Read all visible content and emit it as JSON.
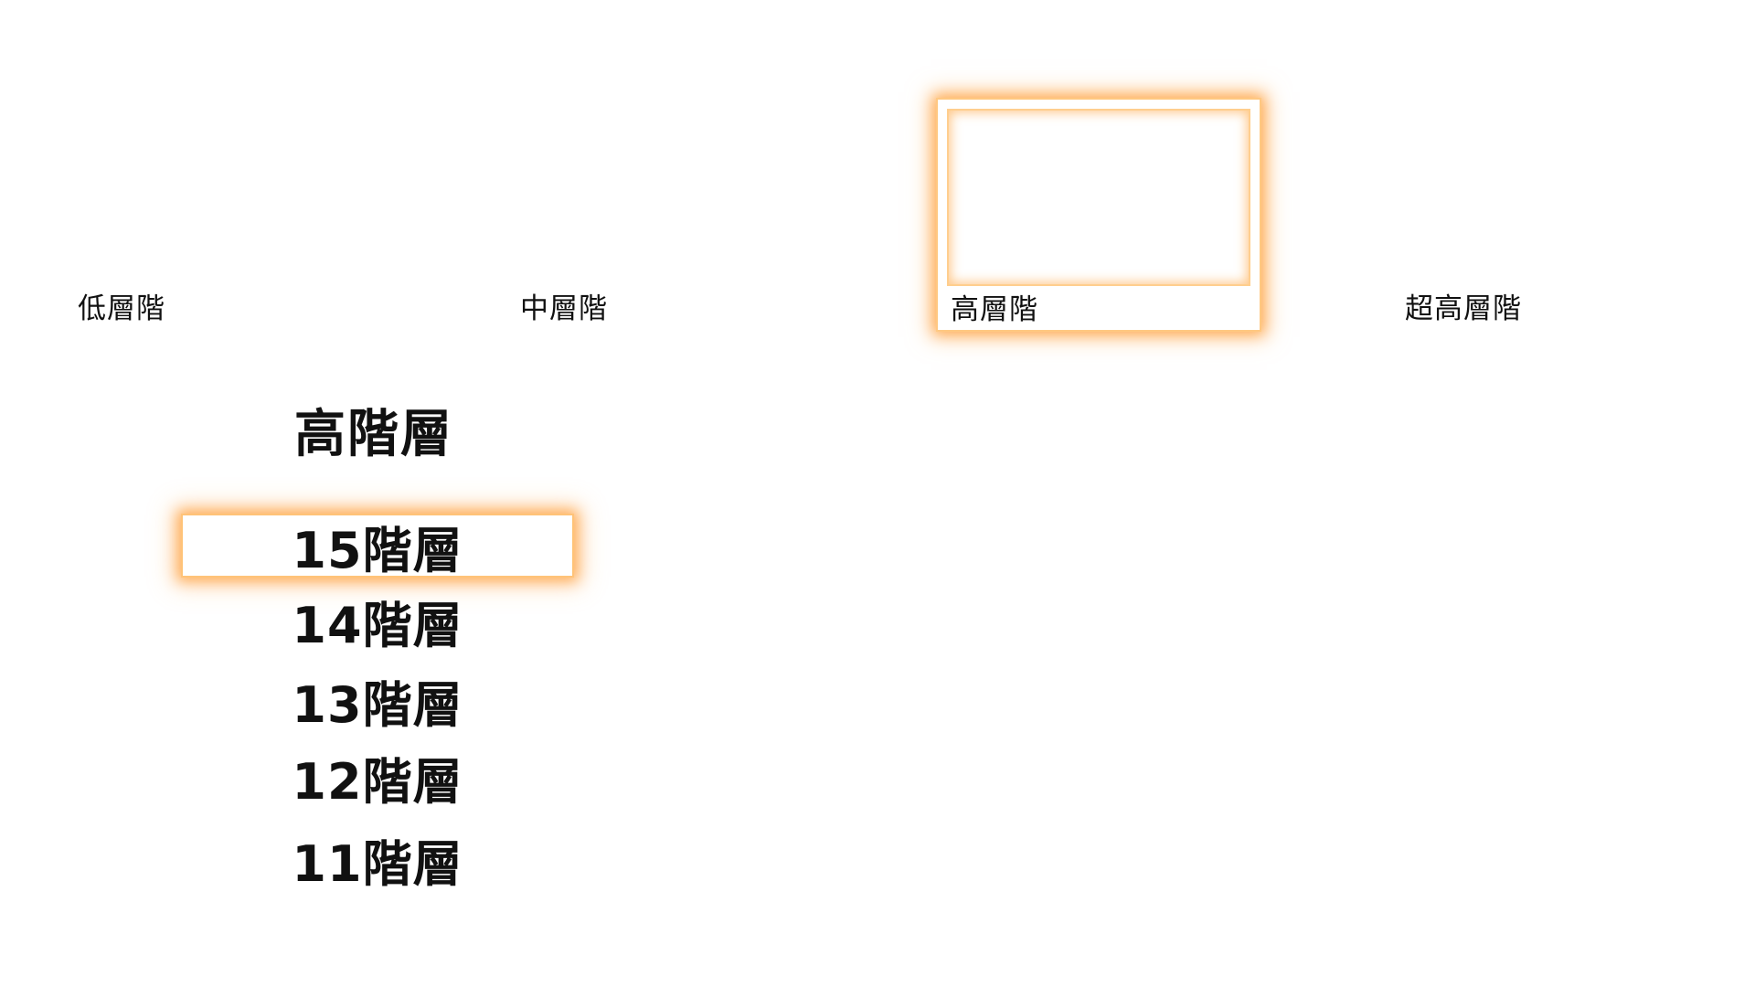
{
  "categories": {
    "low": "低層階",
    "mid": "中層階",
    "high": "高層階",
    "super_high": "超高層階",
    "selected": "高層階"
  },
  "floor_list": {
    "title": "高階層",
    "selected": "15階層",
    "items": [
      {
        "label": "15階層"
      },
      {
        "label": "14階層"
      },
      {
        "label": "13階層"
      },
      {
        "label": "12階層"
      },
      {
        "label": "11階層"
      }
    ]
  },
  "colors": {
    "focus_glow": "#FFA646",
    "background": "#FFFFFF",
    "text": "#111111"
  }
}
